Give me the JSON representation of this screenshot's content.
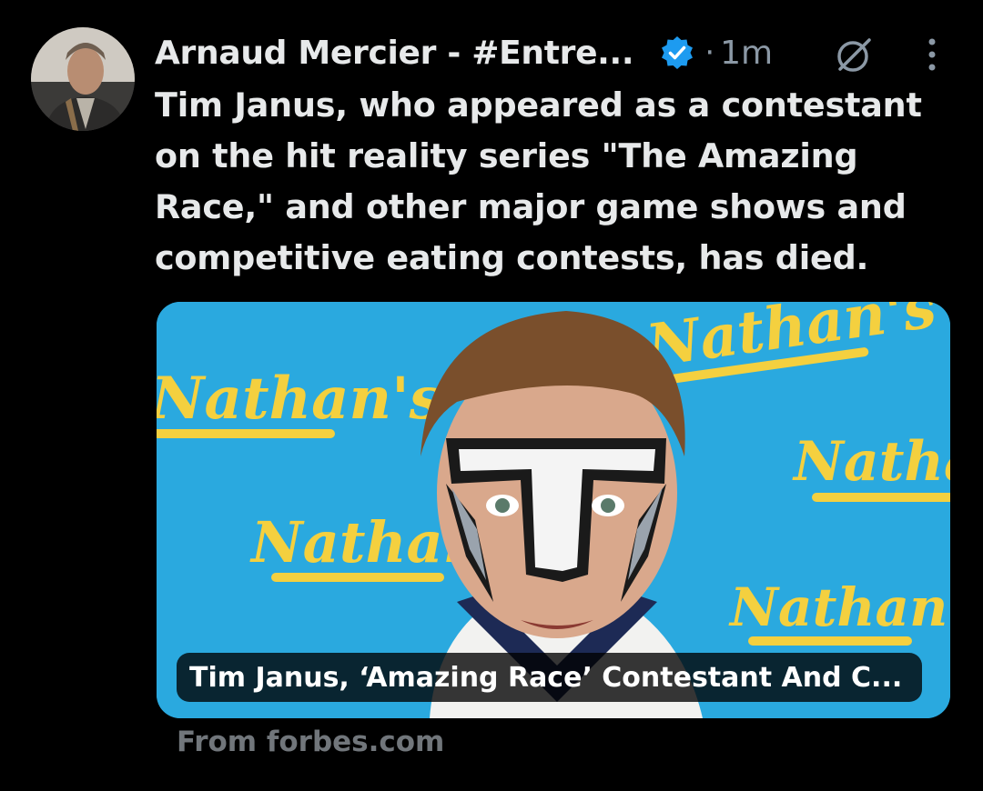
{
  "post": {
    "author_name": "Arnaud Mercier - #Entre...",
    "separator": "·",
    "timestamp": "1m",
    "text_lines": [
      "Tim Janus, who appeared as a contestant",
      "on the hit reality series \"The Amazing",
      "Race,\" and other major game shows and",
      "competitive eating contests, has died."
    ]
  },
  "link_card": {
    "title": "Tim Janus, ‘Amazing Race’ Contestant And C...",
    "source": "From forbes.com",
    "banner_texts": [
      "Nathan's"
    ]
  },
  "icons": {
    "verified": "verified-badge-icon",
    "grok": "grok-icon",
    "more": "more-vertical-icon"
  },
  "colors": {
    "background": "#000000",
    "text_primary": "#e7e9ea",
    "text_secondary": "#71767b",
    "verified_blue": "#1d9bf0",
    "banner_blue": "#2aa9df",
    "banner_yellow": "#f4d03f"
  }
}
